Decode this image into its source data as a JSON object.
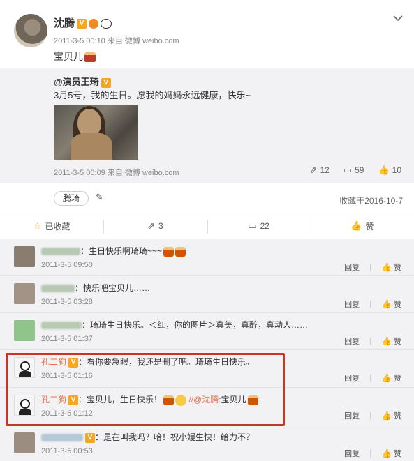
{
  "post": {
    "author": "沈腾",
    "v_badge": "V",
    "meta": "2011-3-5 00:10 来自 微博 weibo.com",
    "text": "宝贝儿",
    "menu_icon": "chevron-down-icon"
  },
  "repost": {
    "author": "@演员王琦",
    "text": "3月5号，我的生日。愿我的妈妈永远健康，快乐~",
    "meta": "2011-3-5 00:09 来自 微博 weibo.com",
    "reposts": "12",
    "comments": "59",
    "likes": "10"
  },
  "tag": {
    "label": "腾琦",
    "favorite_date": "收藏于2016-10-7"
  },
  "actions": {
    "favorited": "已收藏",
    "repost_count": "3",
    "comment_count": "22",
    "like": "赞"
  },
  "comments": [
    {
      "text": "：生日快乐啊琦琦~~~",
      "time": "2011-3-5 09:50"
    },
    {
      "text": "：快乐吧宝贝儿……",
      "time": "2011-3-5 03:28"
    },
    {
      "text": "：琦琦生日快乐。＜红，你的图片＞真美，真醉，真动人……",
      "time": "2011-3-5 01:37"
    },
    {
      "name": "孔二狗",
      "text": "：看你要急眼，我还是删了吧。琦琦生日快乐。",
      "time": "2011-3-5 01:16"
    },
    {
      "name": "孔二狗",
      "text": "：宝贝儿，生日快乐！",
      "mention": " //@沈腾",
      "mention_text": ":宝贝儿",
      "time": "2011-3-5 01:12"
    },
    {
      "text": "：是在叫我吗？哈！祝小嫚生快！给力不？",
      "time": "2011-3-5 00:53"
    }
  ],
  "comment_actions": {
    "reply": "回复",
    "like": "赞"
  },
  "colors": {
    "accent": "#eb7350",
    "highlight_box": "#c0392b",
    "v_badge": "#f5a623"
  }
}
